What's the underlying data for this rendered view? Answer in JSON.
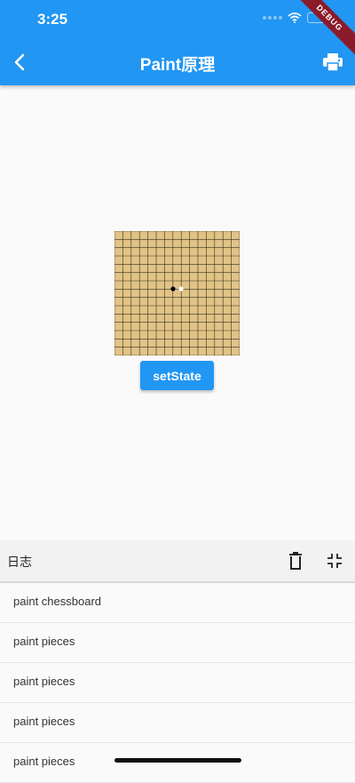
{
  "status_bar": {
    "time": "3:25"
  },
  "app_bar": {
    "title": "Paint原理",
    "back_icon": "chevron-left-icon",
    "print_icon": "printer-icon",
    "debug_label": "DEBUG"
  },
  "board": {
    "grid_lines": 15,
    "board_color": "#e1c386",
    "pieces": [
      {
        "color": "black"
      },
      {
        "color": "white"
      }
    ]
  },
  "button": {
    "label": "setState"
  },
  "log": {
    "title": "日志",
    "delete_icon": "trash-icon",
    "collapse_icon": "collapse-icon",
    "items": [
      {
        "text": "paint chessboard"
      },
      {
        "text": "paint pieces"
      },
      {
        "text": "paint pieces"
      },
      {
        "text": "paint pieces"
      },
      {
        "text": "paint pieces"
      }
    ]
  },
  "colors": {
    "primary": "#2196f3",
    "debug": "#8b1a2b"
  }
}
